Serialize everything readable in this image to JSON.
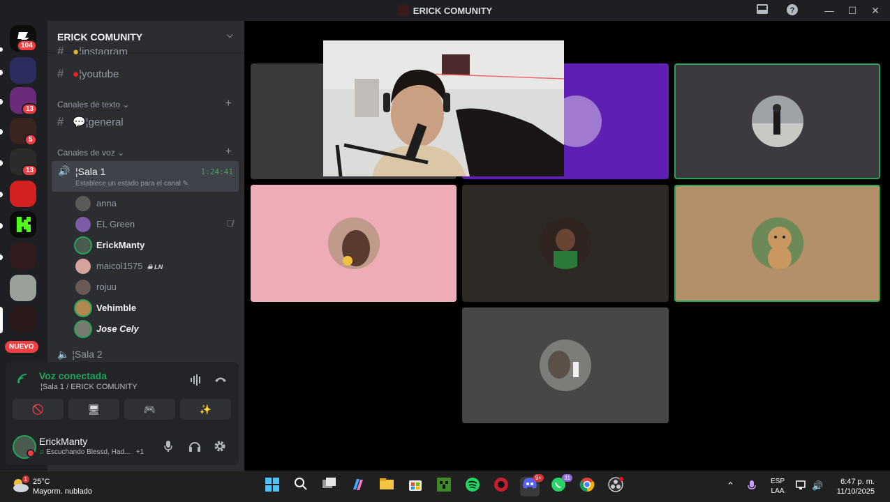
{
  "window": {
    "title": "ERICK COMUNITY",
    "controls": [
      "minimize",
      "maximize",
      "close"
    ]
  },
  "server_rail": {
    "items": [
      {
        "name": "server-1",
        "badge": "104"
      },
      {
        "name": "server-2",
        "badge": ""
      },
      {
        "name": "server-3",
        "badge": "13"
      },
      {
        "name": "server-4",
        "badge": "5"
      },
      {
        "name": "server-5",
        "badge": "13"
      },
      {
        "name": "server-6",
        "badge": ""
      },
      {
        "name": "server-kick",
        "badge": ""
      },
      {
        "name": "server-8",
        "badge": ""
      },
      {
        "name": "server-9",
        "badge": ""
      },
      {
        "name": "server-erick",
        "badge": ""
      }
    ],
    "new_label": "NUEVO"
  },
  "sidebar": {
    "server_name": "ERICK COMUNITY",
    "channels_top": [
      {
        "label": "¦instagram"
      },
      {
        "label": "¦youtube"
      }
    ],
    "text_category": "Canales de texto",
    "text_channels": [
      {
        "label": "¦general"
      }
    ],
    "voice_category": "Canales de voz",
    "active_voice": {
      "name": "¦Sala 1",
      "timer": "1:24:41",
      "status": "Establece un estado para el canal"
    },
    "voice_users": [
      {
        "name": "anna",
        "tag": ""
      },
      {
        "name": "EL Green",
        "tag": ""
      },
      {
        "name": "ErickManty",
        "tag": ""
      },
      {
        "name": "maicol1575",
        "tag": "LN"
      },
      {
        "name": "rojuu",
        "tag": ""
      },
      {
        "name": "Vehimble",
        "tag": ""
      },
      {
        "name": "Jose Cely",
        "tag": ""
      }
    ],
    "voice_channel_2": "¦Sala 2"
  },
  "voice_panel": {
    "status": "Voz conectada",
    "channel": "¦Sala 1 / ERICK COMUNITY"
  },
  "user_panel": {
    "name": "ErickManty",
    "activity": "Escuchando Blessd, Had...",
    "extra": "+1"
  },
  "stage": {
    "tile_colors": [
      "#3a3a3c",
      "#5f1fb2",
      "#3c3a3f",
      "#eeacb7",
      "#2d2a26",
      "#b4906a",
      "#474745"
    ]
  },
  "taskbar": {
    "weather_temp": "25°C",
    "weather_desc": "Mayorm. nublado",
    "lang_top": "ESP",
    "lang_bottom": "LAA",
    "time": "6:47 p. m.",
    "date": "11/10/2025",
    "discord_badge": "9+",
    "whatsapp_badge": "31",
    "weather_badge": "1"
  }
}
